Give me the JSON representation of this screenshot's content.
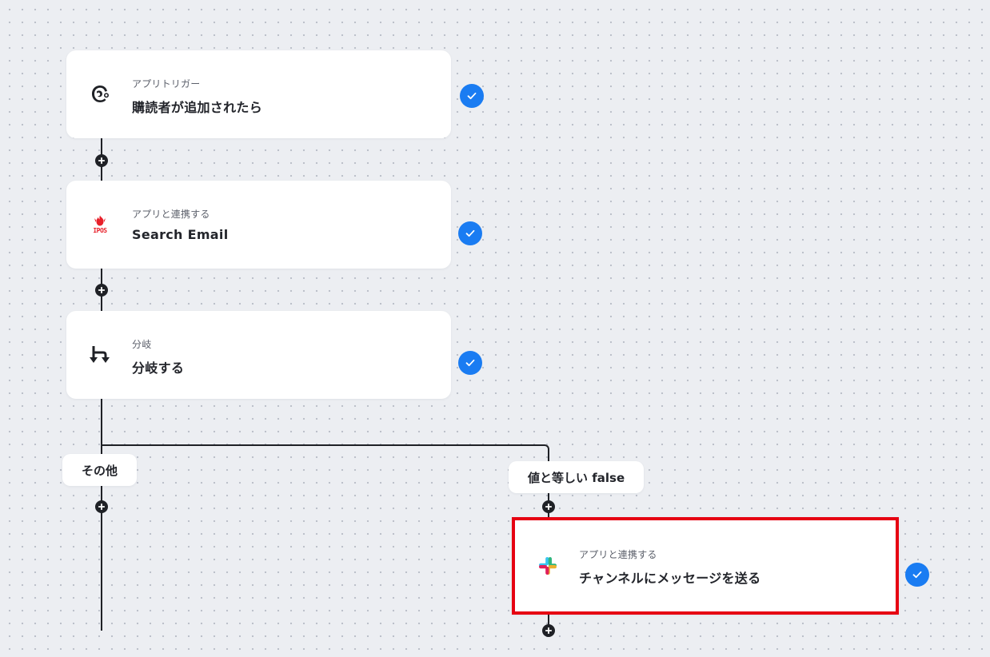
{
  "flow": {
    "steps": [
      {
        "category": "アプリトリガー",
        "title": "購読者が追加されたら",
        "icon": "mailchimp-icon",
        "status": "completed"
      },
      {
        "category": "アプリと連携する",
        "title": "Search Email",
        "icon": "ipos-icon",
        "icon_text": "IPOS",
        "status": "completed"
      },
      {
        "category": "分岐",
        "title": "分岐する",
        "icon": "branch-icon",
        "status": "completed"
      }
    ],
    "branches": [
      {
        "label": "その他"
      },
      {
        "label": "値と等しい false",
        "steps": [
          {
            "category": "アプリと連携する",
            "title": "チャンネルにメッセージを送る",
            "icon": "slack-icon",
            "status": "completed",
            "selected": true
          }
        ]
      }
    ]
  },
  "colors": {
    "canvas_background": "#eceef2",
    "connector": "#1f2126",
    "check_badge": "#1a7cf2",
    "selection_highlight": "#e60012",
    "ipos_brand": "#e8202a",
    "slack_blue": "#36c5f0",
    "slack_green": "#2eb67d",
    "slack_yellow": "#ecb22e",
    "slack_red": "#e01e5a"
  }
}
